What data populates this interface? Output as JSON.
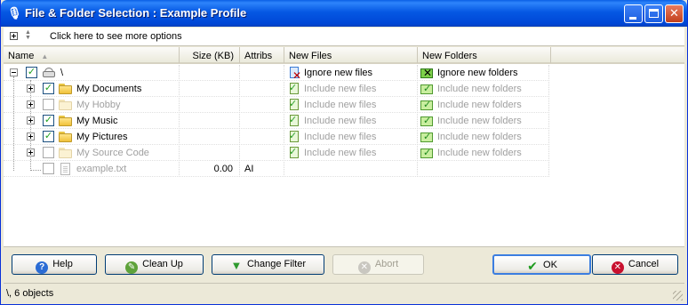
{
  "window": {
    "title": "File & Folder Selection : Example Profile",
    "title_icon": "microphone-icon"
  },
  "options_bar": {
    "label": "Click here to see more options"
  },
  "columns": {
    "name": "Name",
    "size": "Size (KB)",
    "attribs": "Attribs",
    "new_files": "New Files",
    "new_folders": "New Folders"
  },
  "rows": [
    {
      "name": "\\",
      "size": "",
      "attribs": "",
      "new_files": "Ignore new files",
      "new_folders": "Ignore new folders",
      "checked": true,
      "type": "drive",
      "dimmed": false
    },
    {
      "name": "My Documents",
      "size": "",
      "attribs": "",
      "new_files": "Include new files",
      "new_folders": "Include new folders",
      "checked": true,
      "type": "folder",
      "dimmed": false
    },
    {
      "name": "My Hobby",
      "size": "",
      "attribs": "",
      "new_files": "Include new files",
      "new_folders": "Include new folders",
      "checked": false,
      "type": "folder",
      "dimmed": true
    },
    {
      "name": "My Music",
      "size": "",
      "attribs": "",
      "new_files": "Include new files",
      "new_folders": "Include new folders",
      "checked": true,
      "type": "folder",
      "dimmed": false
    },
    {
      "name": "My Pictures",
      "size": "",
      "attribs": "",
      "new_files": "Include new files",
      "new_folders": "Include new folders",
      "checked": true,
      "type": "folder",
      "dimmed": false
    },
    {
      "name": "My Source Code",
      "size": "",
      "attribs": "",
      "new_files": "Include new files",
      "new_folders": "Include new folders",
      "checked": false,
      "type": "folder",
      "dimmed": true
    },
    {
      "name": "example.txt",
      "size": "0.00",
      "attribs": "AI",
      "new_files": "",
      "new_folders": "",
      "checked": false,
      "type": "file",
      "dimmed": true
    }
  ],
  "buttons": {
    "help": "Help",
    "cleanup": "Clean Up",
    "change_filter": "Change Filter",
    "abort": "Abort",
    "ok": "OK",
    "cancel": "Cancel"
  },
  "status": {
    "text": "\\, 6 objects"
  },
  "colors": {
    "title_bar": "#0558e3",
    "ignore_text": "#000000",
    "include_text": "#a0a0a0"
  }
}
